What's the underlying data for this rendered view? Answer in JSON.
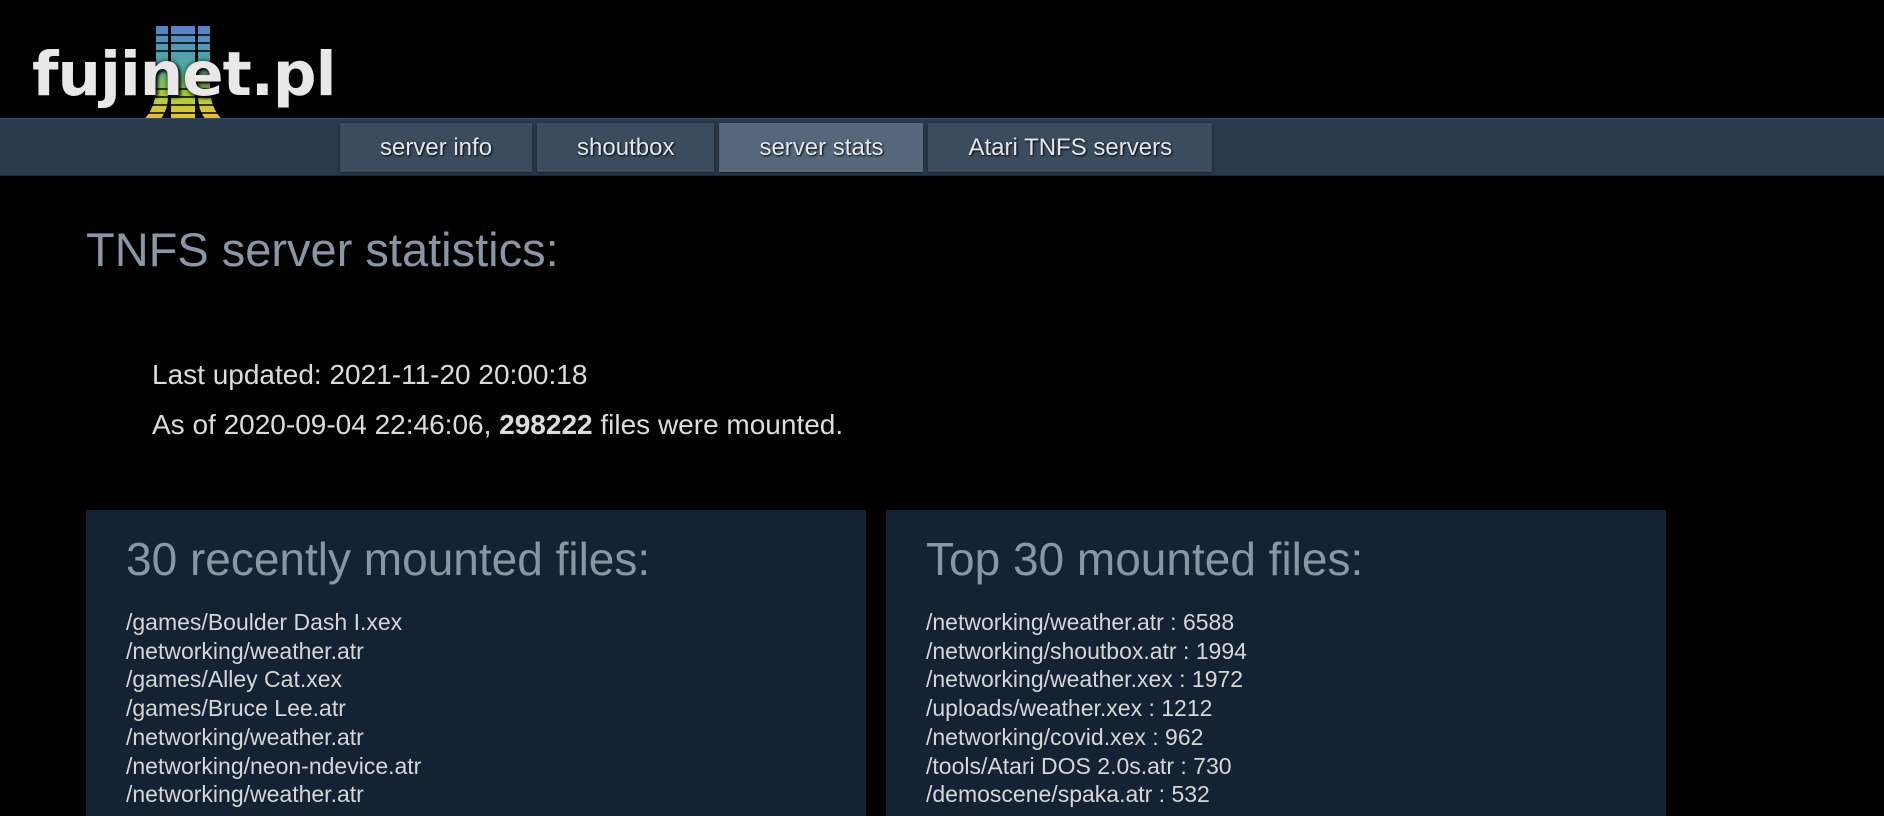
{
  "site": {
    "logo_text": "fujinet.pl",
    "logo_icon": "atari-fuji-icon",
    "colors": {
      "background": "#000000",
      "navbar": "#2b3a4c",
      "tab": "#3c4c5f",
      "tab_active": "#56677b",
      "panel": "#142233",
      "heading": "#8a96a6"
    }
  },
  "nav": {
    "tabs": [
      {
        "label": "server info",
        "active": false
      },
      {
        "label": "shoutbox",
        "active": false
      },
      {
        "label": "server stats",
        "active": true
      },
      {
        "label": "Atari TNFS servers",
        "active": false
      }
    ]
  },
  "main": {
    "title": "TNFS server statistics:",
    "last_updated_label": "Last updated: ",
    "last_updated": "2021-11-20 20:00:18",
    "mounted_prefix": "As of ",
    "mounted_since": "2020-09-04 22:46:06",
    "mounted_sep": ", ",
    "mounted_count": "298222",
    "mounted_suffix": " files were mounted."
  },
  "recent": {
    "title": "30 recently mounted files:",
    "items": [
      "/games/Boulder Dash I.xex",
      "/networking/weather.atr",
      "/games/Alley Cat.xex",
      "/games/Bruce Lee.atr",
      "/networking/weather.atr",
      "/networking/neon-ndevice.atr",
      "/networking/weather.atr"
    ]
  },
  "top": {
    "title": "Top 30 mounted files:",
    "items": [
      "/networking/weather.atr : 6588",
      "/networking/shoutbox.atr : 1994",
      "/networking/weather.xex : 1972",
      "/uploads/weather.xex : 1212",
      "/networking/covid.xex : 962",
      "/tools/Atari DOS 2.0s.atr : 730",
      "/demoscene/spaka.atr : 532"
    ]
  }
}
